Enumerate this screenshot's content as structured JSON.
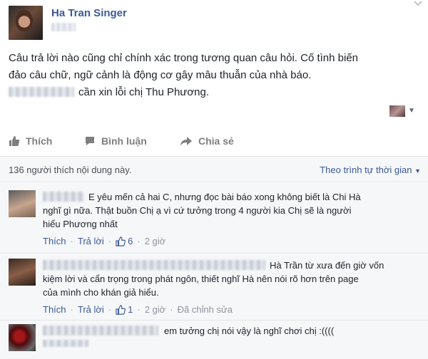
{
  "post": {
    "author": "Ha Tran Singer",
    "line1": "Câu trả lời nào cũng chỉ chính xác trong tương quan câu hỏi. Cố tình biến",
    "line2": "đảo câu chữ, ngữ cảnh là động cơ gây mâu thuẫn của nhà báo.",
    "line3": "cần xin lỗi chị Thu Phương."
  },
  "actions": {
    "like": "Thích",
    "comment": "Bình luận",
    "share": "Chia sẻ"
  },
  "likes": {
    "count_text": "136 người thích nội dung này.",
    "sort_label": "Theo trình tự thời gian"
  },
  "comments": [
    {
      "line1": "E yêu mến cả hai C, nhưng đọc bài báo xong không biết là Chi Hà",
      "line2": "nghĩ gì nữa. Thật buồn Chị ạ vì cứ tưởng trong 4 người kia Chị sẽ là người",
      "line3": "hiểu Phương nhất",
      "like_label": "Thích",
      "reply_label": "Trả lời",
      "likes": "6",
      "time": "2 giờ"
    },
    {
      "line1": "Hà Trần từ xưa đến giờ vốn",
      "line2": "kiệm lời và cẩn trọng trong phát ngôn, thiết nghĩ Hà nên nói rõ hơn trên page",
      "line3": "của mình cho khán giả hiểu.",
      "like_label": "Thích",
      "reply_label": "Trả lời",
      "likes": "1",
      "time": "2 giờ",
      "edited": "Đã chỉnh sửa"
    },
    {
      "line1": "em tưởng chị nói vậy là nghĩ chơi chị :(((("
    }
  ],
  "colors": {
    "link": "#3b5998",
    "muted": "#90949c",
    "action": "#7f7f7f",
    "panel": "#f6f7f9"
  },
  "icons": [
    "chevron-down-icon",
    "thumbs-up-icon",
    "comment-icon",
    "share-arrow-icon",
    "like-count-icon"
  ]
}
